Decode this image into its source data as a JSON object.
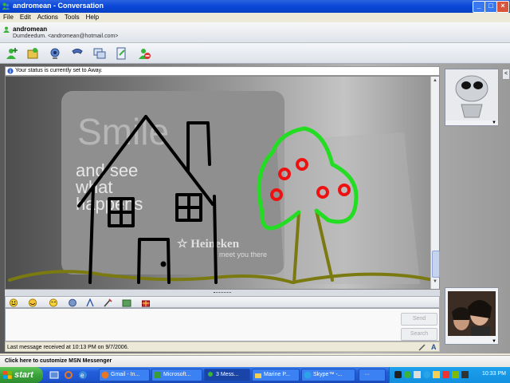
{
  "window": {
    "title": "andromean - Conversation",
    "controls": {
      "minimize": "_",
      "maximize": "□",
      "close": "×"
    }
  },
  "menu": [
    "File",
    "Edit",
    "Actions",
    "Tools",
    "Help"
  ],
  "contact": {
    "name": "andromean",
    "subline": "Dumdeedum.  <andromean@hotmail.com>"
  },
  "status_strip": "Your status is currently set to Away.",
  "drawing": {
    "sign_lines": [
      "Smile",
      "and see",
      "what",
      "happens"
    ],
    "sign_brand": "☆ Heineken",
    "sign_tagline": "meet you there"
  },
  "input": {
    "send_label": "Send",
    "search_label": "Search"
  },
  "last_message": "Last message received at 10:13 PM on 9/7/2006.",
  "customize_bar": "Click here to customize MSN Messenger",
  "taskbar": {
    "start_label": "start",
    "tasks": [
      "Gmail - In...",
      "Microsoft...",
      "3 Mess...",
      "Marine P...",
      "Skype™ -...",
      "···"
    ],
    "clock": "10:33 PM"
  },
  "colors": {
    "titlebar": "#0a46d8",
    "house_stroke": "#000000",
    "tree_foliage": "#22dd22",
    "apples": "#ee1111",
    "ground": "#7a7a10"
  }
}
